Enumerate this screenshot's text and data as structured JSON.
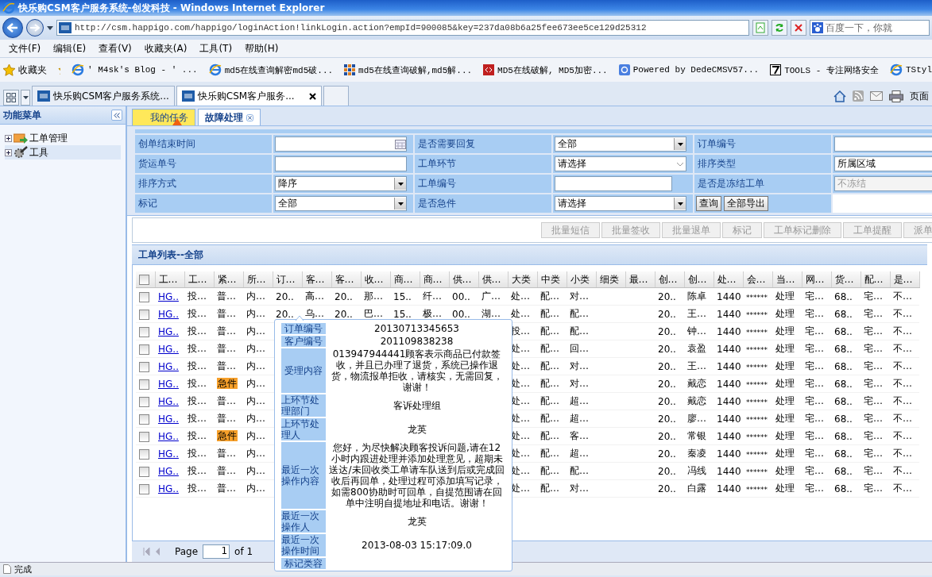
{
  "window": {
    "title": "快乐购CSM客户服务系统-创发科技 - Windows Internet Explorer"
  },
  "address_bar": {
    "url": "http://csm.happigo.com/happigo/loginAction!linkLogin.action?empId=900085&key=237da08b6a25fee673ee5ce129d25312"
  },
  "search_field": {
    "placeholder": "百度一下，你就"
  },
  "menu_bar": [
    "文件(F)",
    "编辑(E)",
    "查看(V)",
    "收藏夹(A)",
    "工具(T)",
    "帮助(H)"
  ],
  "favorites_bar": {
    "label": "收藏夹",
    "items": [
      {
        "label": "' M4sk's Blog - ' ...",
        "kind": "page"
      },
      {
        "label": "md5在线查询解密md5破...",
        "kind": "page"
      },
      {
        "label": "md5在线查询破解,md5解...",
        "kind": "grid"
      },
      {
        "label": "MD5在线破解, MD5加密...",
        "kind": "red"
      },
      {
        "label": "Powered by DedeCMSV57...",
        "kind": "blue"
      },
      {
        "label": "TOOLS - 专注网络安全",
        "kind": "seven"
      },
      {
        "label": "TStyl",
        "kind": "page"
      }
    ]
  },
  "browser_tabs": [
    {
      "label": "快乐购CSM客户服务系统...",
      "selected": false
    },
    {
      "label": "快乐购CSM客户服务...",
      "selected": true
    }
  ],
  "command_bar": {
    "page_label": "页面"
  },
  "sidebar": {
    "title": "功能菜单",
    "items": [
      {
        "label": "工单管理",
        "expanded": false,
        "kind": "folder"
      },
      {
        "label": "工具",
        "expanded": false,
        "kind": "tools"
      }
    ]
  },
  "app_tabs": [
    {
      "label": "我的任务",
      "selected": false,
      "alert": true
    },
    {
      "label": "故障处理",
      "selected": true
    }
  ],
  "filters": [
    {
      "label": "创单结束时间",
      "kind": "date"
    },
    {
      "label": "是否需要回复",
      "kind": "select",
      "value": "全部"
    },
    {
      "label": "订单编号",
      "kind": "text"
    },
    {
      "label": "货运单号",
      "kind": "text"
    },
    {
      "label": "工单环节",
      "kind": "combo",
      "value": "请选择"
    },
    {
      "label": "排序类型",
      "kind": "text",
      "value": "所属区域"
    },
    {
      "label": "排序方式",
      "kind": "select",
      "value": "降序"
    },
    {
      "label": "工单编号",
      "kind": "short"
    },
    {
      "label": "是否是冻结工单",
      "kind": "text",
      "value": "不冻结",
      "disabled": true
    },
    {
      "label": "标记",
      "kind": "select",
      "value": "全部"
    },
    {
      "label": "是否急件",
      "kind": "select",
      "value": "请选择"
    }
  ],
  "filter_buttons": [
    "查询",
    "全部导出"
  ],
  "actions": [
    {
      "label": "批量短信",
      "disabled": true
    },
    {
      "label": "批量签收",
      "disabled": true
    },
    {
      "label": "批量退单",
      "disabled": true
    },
    {
      "label": "标记",
      "disabled": true
    },
    {
      "label": "工单标记删除",
      "disabled": true
    },
    {
      "label": "工单提醒",
      "disabled": true
    },
    {
      "label": "派单",
      "disabled": true
    }
  ],
  "list_title": "工单列表--全部",
  "table": {
    "header_checked": false,
    "columns": [
      "工…",
      "工…",
      "紧…",
      "所…",
      "订…",
      "客…",
      "客…",
      "收…",
      "商…",
      "商…",
      "供…",
      "供…",
      "大类",
      "中类",
      "小类",
      "细类",
      "最…",
      "创…",
      "创…",
      "处…",
      "会…",
      "当…",
      "网…",
      "货…",
      "配…",
      "是…"
    ],
    "rows": [
      {
        "checked": false,
        "urgent": false,
        "cells": [
          "HG..",
          "投…",
          "普…",
          "内…",
          "20..",
          "高…",
          "20..",
          "那…",
          "15..",
          "纤…",
          "00..",
          "广…",
          "处…",
          "配…",
          "对…",
          null,
          null,
          "20..",
          "陈卓",
          "1440",
          "******",
          "处理",
          "宅…",
          "68..",
          "宅…",
          "不…"
        ]
      },
      {
        "checked": false,
        "urgent": false,
        "cells": [
          "HG..",
          "投…",
          "普…",
          "内…",
          "20..",
          "乌…",
          "20..",
          "巴…",
          "15..",
          "极…",
          "00..",
          "湖…",
          "处…",
          "配…",
          "配…",
          null,
          null,
          "20..",
          "王…",
          "1440",
          "******",
          "处理",
          "宅…",
          "68..",
          "宅…",
          "不…"
        ]
      },
      {
        "checked": false,
        "urgent": false,
        "cells": [
          "HG..",
          "投…",
          "普…",
          "内…",
          null,
          null,
          null,
          null,
          null,
          null,
          null,
          null,
          "投…",
          "配…",
          "配…",
          null,
          null,
          "20..",
          "钟…",
          "1440",
          "******",
          "处理",
          "宅…",
          "68..",
          "宅…",
          "不…"
        ]
      },
      {
        "checked": false,
        "urgent": false,
        "cells": [
          "HG..",
          "投…",
          "普…",
          "内…",
          null,
          null,
          null,
          null,
          null,
          null,
          null,
          null,
          "处…",
          "配…",
          "回…",
          null,
          null,
          "20..",
          "袁盈",
          "1440",
          "******",
          "处理",
          "宅…",
          "68..",
          "宅…",
          "不…"
        ]
      },
      {
        "checked": false,
        "urgent": false,
        "cells": [
          "HG..",
          "投…",
          "普…",
          "内…",
          null,
          null,
          null,
          null,
          null,
          null,
          null,
          null,
          "处…",
          "配…",
          "对…",
          null,
          null,
          "20..",
          "王…",
          "1440",
          "******",
          "处理",
          "宅…",
          "68..",
          "宅…",
          "不…"
        ]
      },
      {
        "checked": false,
        "urgent": true,
        "cells": [
          "HG..",
          "投…",
          "急件",
          "内…",
          null,
          null,
          null,
          null,
          null,
          null,
          null,
          null,
          "处…",
          "配…",
          "对…",
          null,
          null,
          "20..",
          "戴恋",
          "1440",
          "******",
          "处理",
          "宅…",
          "68..",
          "宅…",
          "不…"
        ]
      },
      {
        "checked": false,
        "urgent": false,
        "cells": [
          "HG..",
          "投…",
          "普…",
          "内…",
          null,
          null,
          null,
          null,
          null,
          null,
          null,
          null,
          "处…",
          "配…",
          "超…",
          null,
          null,
          "20..",
          "戴恋",
          "1440",
          "******",
          "处理",
          "宅…",
          "68..",
          "宅…",
          "不…"
        ]
      },
      {
        "checked": false,
        "urgent": false,
        "cells": [
          "HG..",
          "投…",
          "普…",
          "内…",
          null,
          null,
          null,
          null,
          null,
          null,
          null,
          null,
          "处…",
          "配…",
          "超…",
          null,
          null,
          "20..",
          "廖…",
          "1440",
          "******",
          "处理",
          "宅…",
          "68..",
          "宅…",
          "不…"
        ]
      },
      {
        "checked": false,
        "urgent": true,
        "cells": [
          "HG..",
          "投…",
          "急件",
          "内…",
          null,
          null,
          null,
          null,
          null,
          null,
          null,
          null,
          "处…",
          "配…",
          "客…",
          null,
          null,
          "20..",
          "常银",
          "1440",
          "******",
          "处理",
          "宅…",
          "68..",
          "宅…",
          "不…"
        ]
      },
      {
        "checked": false,
        "urgent": false,
        "cells": [
          "HG..",
          "投…",
          "普…",
          "内…",
          null,
          null,
          null,
          null,
          null,
          null,
          null,
          null,
          "处…",
          "配…",
          "超…",
          null,
          null,
          "20..",
          "秦凌",
          "1440",
          "******",
          "处理",
          "宅…",
          "68..",
          "宅…",
          "不…"
        ]
      },
      {
        "checked": false,
        "urgent": false,
        "cells": [
          "HG..",
          "投…",
          "普…",
          "内…",
          null,
          null,
          null,
          null,
          null,
          null,
          null,
          null,
          "处…",
          "配…",
          "配…",
          null,
          null,
          "20..",
          "冯线",
          "1440",
          "******",
          "处理",
          "宅…",
          "68..",
          "宅…",
          "不…"
        ]
      },
      {
        "checked": false,
        "urgent": false,
        "cells": [
          "HG..",
          "投…",
          "普…",
          "内…",
          null,
          null,
          null,
          null,
          null,
          null,
          null,
          null,
          "处…",
          "配…",
          "对…",
          null,
          null,
          "20..",
          "白露",
          "1440",
          "******",
          "处理",
          "宅…",
          "68..",
          "宅…",
          "不…"
        ]
      }
    ]
  },
  "tooltip": {
    "rows": [
      {
        "label": "订单编号",
        "value": "20130713345653"
      },
      {
        "label": "客户编号",
        "value": "201109838238"
      },
      {
        "label": "受理内容",
        "value": "013947944441顾客表示商品已付款签收，并且已办理了退货，系统已操作退货，物流报单拒收，请核实，无需回复，谢谢！"
      },
      {
        "label": "上环节处理部门",
        "value": "客诉处理组"
      },
      {
        "label": "上环节处理人",
        "value": "龙英"
      },
      {
        "label": "最近一次操作内容",
        "value": "您好，为尽快解决顾客投诉问题,请在12小时内跟进处理并添加处理意见，超期未送达/未回收类工单请车队送到后或完成回收后再回单，处理过程可添加填写记录，如需800协助时可回单，自提范围请在回单中注明自提地址和电话。谢谢！"
      },
      {
        "label": "最近一次操作人",
        "value": "龙英"
      },
      {
        "label": "最近一次操作时间",
        "value": "2013-08-03 15:17:09.0"
      },
      {
        "label": "标记类容"
      }
    ]
  },
  "pager": {
    "label": "Page",
    "value": "1",
    "total": "of 1"
  },
  "status_bar": {
    "text": "完成"
  }
}
